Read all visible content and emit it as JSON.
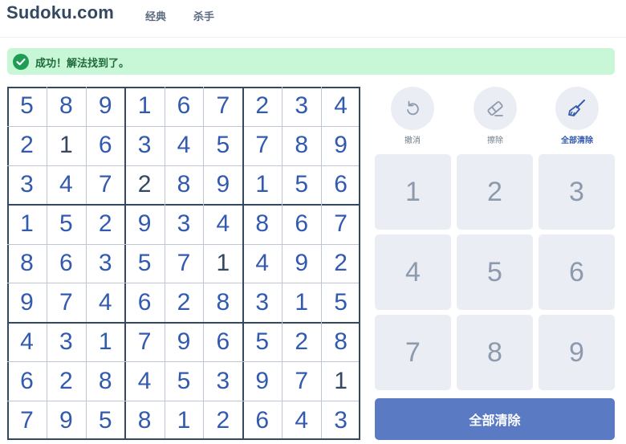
{
  "header": {
    "logo": "Sudoku.com",
    "nav": [
      "经典",
      "杀手"
    ]
  },
  "banner": {
    "message": "成功！解法找到了。",
    "icon": "check-circle-icon",
    "color": "#1f9d55"
  },
  "board": {
    "rows": [
      [
        "5",
        "8",
        "9",
        "1",
        "6",
        "7",
        "2",
        "3",
        "4"
      ],
      [
        "2",
        "1",
        "6",
        "3",
        "4",
        "5",
        "7",
        "8",
        "9"
      ],
      [
        "3",
        "4",
        "7",
        "2",
        "8",
        "9",
        "1",
        "5",
        "6"
      ],
      [
        "1",
        "5",
        "2",
        "9",
        "3",
        "4",
        "8",
        "6",
        "7"
      ],
      [
        "8",
        "6",
        "3",
        "5",
        "7",
        "1",
        "4",
        "9",
        "2"
      ],
      [
        "9",
        "7",
        "4",
        "6",
        "2",
        "8",
        "3",
        "1",
        "5"
      ],
      [
        "4",
        "3",
        "1",
        "7",
        "9",
        "6",
        "5",
        "2",
        "8"
      ],
      [
        "6",
        "2",
        "8",
        "4",
        "5",
        "3",
        "9",
        "7",
        "1"
      ],
      [
        "7",
        "9",
        "5",
        "8",
        "1",
        "2",
        "6",
        "4",
        "3"
      ]
    ],
    "given": [
      [
        0,
        0,
        0,
        0,
        0,
        0,
        0,
        0,
        0
      ],
      [
        0,
        1,
        0,
        0,
        0,
        0,
        0,
        0,
        0
      ],
      [
        0,
        0,
        0,
        1,
        0,
        0,
        0,
        0,
        0
      ],
      [
        0,
        0,
        0,
        0,
        0,
        0,
        0,
        0,
        0
      ],
      [
        0,
        0,
        0,
        0,
        0,
        1,
        0,
        0,
        0
      ],
      [
        0,
        0,
        0,
        0,
        0,
        0,
        0,
        0,
        0
      ],
      [
        0,
        0,
        0,
        0,
        0,
        0,
        0,
        0,
        0
      ],
      [
        0,
        0,
        0,
        0,
        0,
        0,
        0,
        0,
        1
      ],
      [
        0,
        0,
        0,
        0,
        0,
        0,
        0,
        0,
        0
      ]
    ],
    "colors": {
      "filled": "#325aaf",
      "given": "#344861"
    }
  },
  "tools": [
    {
      "label": "撤消",
      "icon": "undo-icon",
      "active": false
    },
    {
      "label": "擦除",
      "icon": "eraser-icon",
      "active": false
    },
    {
      "label": "全部清除",
      "icon": "broom-icon",
      "active": true
    }
  ],
  "numpad": [
    "1",
    "2",
    "3",
    "4",
    "5",
    "6",
    "7",
    "8",
    "9"
  ],
  "action_button": "全部清除"
}
